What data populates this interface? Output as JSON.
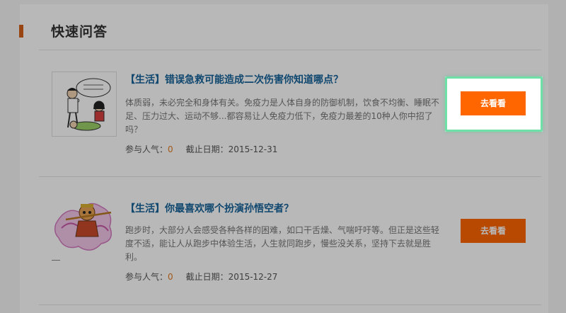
{
  "section": {
    "title": "快速问答"
  },
  "items": [
    {
      "title": "【生活】错误急救可能造成二次伤害你知道哪点？",
      "description": "体质弱，未必完全和身体有关。免疫力是人体自身的防御机制，饮食不均衡、睡眠不足、压力过大、运动不够...都容易让人免疫力低下，免疫力最差的10种人你中招了吗？",
      "popularity_label": "参与人气：",
      "popularity": "0",
      "deadline_label": "截止日期：",
      "deadline": "2015-12-31",
      "button_label": "去看看",
      "image_icon": "first-aid-cartoon-image"
    },
    {
      "title": "【生活】你最喜欢哪个扮演孙悟空者？",
      "description": "跑步时，大部分人会感受各种各样的困难，如口干舌燥、气喘吁吁等。但正是这些轻度不适，能让人从跑步中体验生活，人生就同跑步，慢些没关系，坚持下去就是胜利。",
      "popularity_label": "参与人气：",
      "popularity": "0",
      "deadline_label": "截止日期：",
      "deadline": "2015-12-27",
      "button_label": "去看看",
      "image_icon": "monkey-king-image"
    }
  ],
  "colors": {
    "accent": "#ff6600",
    "title_link": "#16639a",
    "count": "#e07b20",
    "highlight": "#6ee0a8",
    "section_bar": "#d4601a"
  }
}
